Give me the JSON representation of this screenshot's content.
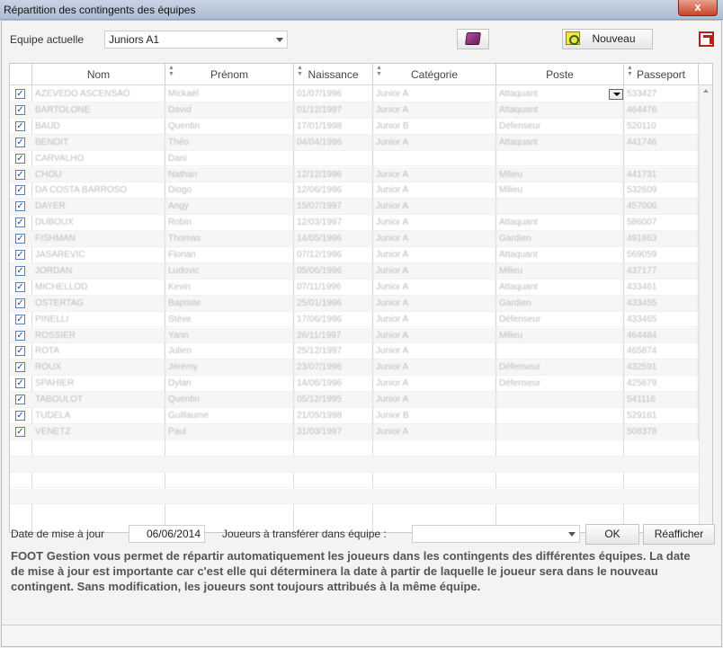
{
  "window": {
    "title": "Répartition des contingents des équipes",
    "close_label": "x"
  },
  "toolbar": {
    "team_label": "Equipe actuelle",
    "team_value": "Juniors A1",
    "new_label": "Nouveau"
  },
  "grid": {
    "columns": [
      "Nom",
      "Prénom",
      "Naissance",
      "Catégorie",
      "Poste",
      "Passeport"
    ],
    "rows": [
      {
        "checked": true,
        "nom": "AZEVEDO ASCENSAO",
        "prenom": "Mickaël",
        "naissance": "01/07/1996",
        "categorie": "Junior A",
        "poste": "Attaquant",
        "passeport": "533427"
      },
      {
        "checked": true,
        "nom": "BARTOLONE",
        "prenom": "David",
        "naissance": "01/12/1997",
        "categorie": "Junior A",
        "poste": "Attaquant",
        "passeport": "464476"
      },
      {
        "checked": true,
        "nom": "BAUD",
        "prenom": "Quentin",
        "naissance": "17/01/1998",
        "categorie": "Junior B",
        "poste": "Défenseur",
        "passeport": "520110"
      },
      {
        "checked": true,
        "nom": "BENOIT",
        "prenom": "Théo",
        "naissance": "04/04/1996",
        "categorie": "Junior A",
        "poste": "Attaquant",
        "passeport": "441746"
      },
      {
        "checked": true,
        "nom": "CARVALHO",
        "prenom": "Dani",
        "naissance": "",
        "categorie": "",
        "poste": "",
        "passeport": ""
      },
      {
        "checked": true,
        "nom": "CHOU",
        "prenom": "Nathan",
        "naissance": "12/12/1996",
        "categorie": "Junior A",
        "poste": "Milieu",
        "passeport": "441731"
      },
      {
        "checked": true,
        "nom": "DA COSTA BARROSO",
        "prenom": "Diogo",
        "naissance": "12/06/1996",
        "categorie": "Junior A",
        "poste": "Milieu",
        "passeport": "532609"
      },
      {
        "checked": true,
        "nom": "DAYER",
        "prenom": "Angy",
        "naissance": "15/07/1997",
        "categorie": "Junior A",
        "poste": "",
        "passeport": "457006"
      },
      {
        "checked": true,
        "nom": "DUBOUX",
        "prenom": "Robin",
        "naissance": "12/03/1997",
        "categorie": "Junior A",
        "poste": "Attaquant",
        "passeport": "586007"
      },
      {
        "checked": true,
        "nom": "FISHMAN",
        "prenom": "Thomas",
        "naissance": "14/05/1996",
        "categorie": "Junior A",
        "poste": "Gardien",
        "passeport": "491863"
      },
      {
        "checked": true,
        "nom": "JASAREVIC",
        "prenom": "Florian",
        "naissance": "07/12/1996",
        "categorie": "Junior A",
        "poste": "Attaquant",
        "passeport": "569059"
      },
      {
        "checked": true,
        "nom": "JORDAN",
        "prenom": "Ludovic",
        "naissance": "05/06/1996",
        "categorie": "Junior A",
        "poste": "Milieu",
        "passeport": "437177"
      },
      {
        "checked": true,
        "nom": "MICHELLOD",
        "prenom": "Kevin",
        "naissance": "07/11/1996",
        "categorie": "Junior A",
        "poste": "Attaquant",
        "passeport": "433461"
      },
      {
        "checked": true,
        "nom": "OSTERTAG",
        "prenom": "Baptiste",
        "naissance": "25/01/1996",
        "categorie": "Junior A",
        "poste": "Gardien",
        "passeport": "433455"
      },
      {
        "checked": true,
        "nom": "PINELLI",
        "prenom": "Stève",
        "naissance": "17/06/1996",
        "categorie": "Junior A",
        "poste": "Défenseur",
        "passeport": "433465"
      },
      {
        "checked": true,
        "nom": "ROSSIER",
        "prenom": "Yann",
        "naissance": "26/11/1997",
        "categorie": "Junior A",
        "poste": "Milieu",
        "passeport": "464484"
      },
      {
        "checked": true,
        "nom": "ROTA",
        "prenom": "Julien",
        "naissance": "25/12/1997",
        "categorie": "Junior A",
        "poste": "",
        "passeport": "465874"
      },
      {
        "checked": true,
        "nom": "ROUX",
        "prenom": "Jérémy",
        "naissance": "23/07/1996",
        "categorie": "Junior A",
        "poste": "Défenseur",
        "passeport": "432591"
      },
      {
        "checked": true,
        "nom": "SPAHIER",
        "prenom": "Dylan",
        "naissance": "14/06/1996",
        "categorie": "Junior A",
        "poste": "Défenseur",
        "passeport": "425679"
      },
      {
        "checked": true,
        "nom": "TABOULOT",
        "prenom": "Quentin",
        "naissance": "05/12/1995",
        "categorie": "Junior A",
        "poste": "",
        "passeport": "541116"
      },
      {
        "checked": true,
        "nom": "TUDELA",
        "prenom": "Guillaume",
        "naissance": "21/05/1998",
        "categorie": "Junior B",
        "poste": "",
        "passeport": "529181"
      },
      {
        "checked": true,
        "nom": "VENETZ",
        "prenom": "Paul",
        "naissance": "31/03/1997",
        "categorie": "Junior A",
        "poste": "",
        "passeport": "508378"
      }
    ]
  },
  "footer": {
    "date_label": "Date de mise à jour",
    "date_value": "06/06/2014",
    "transfer_label": "Joueurs à transférer dans équipe :",
    "transfer_value": "",
    "ok_label": "OK",
    "refresh_label": "Réafficher",
    "help_text": "FOOT Gestion vous permet de répartir automatiquement les joueurs dans les contingents des différentes équipes. La date de mise à jour est importante car c'est elle qui déterminera la date à partir de laquelle le joueur sera dans le nouveau contingent. Sans modification, les joueurs sont toujours attribués à la même équipe."
  }
}
